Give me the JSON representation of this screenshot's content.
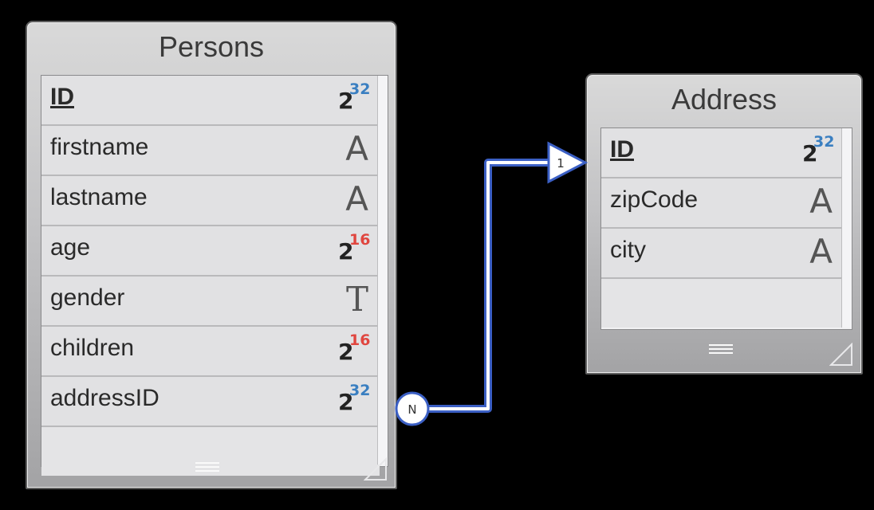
{
  "persons": {
    "title": "Persons",
    "fields": [
      {
        "name": "ID",
        "pk": true,
        "type": "int",
        "exp": "32",
        "exp_color": "#3a7fc1"
      },
      {
        "name": "firstname",
        "pk": false,
        "type": "text",
        "glyph": "A"
      },
      {
        "name": "lastname",
        "pk": false,
        "type": "text",
        "glyph": "A"
      },
      {
        "name": "age",
        "pk": false,
        "type": "int",
        "exp": "16",
        "exp_color": "#e0463f"
      },
      {
        "name": "gender",
        "pk": false,
        "type": "text-t",
        "glyph": "T"
      },
      {
        "name": "children",
        "pk": false,
        "type": "int",
        "exp": "16",
        "exp_color": "#e0463f"
      },
      {
        "name": "addressID",
        "pk": false,
        "type": "int",
        "exp": "32",
        "exp_color": "#3a7fc1"
      }
    ]
  },
  "address": {
    "title": "Address",
    "fields": [
      {
        "name": "ID",
        "pk": true,
        "type": "int",
        "exp": "32",
        "exp_color": "#3a7fc1"
      },
      {
        "name": "zipCode",
        "pk": false,
        "type": "text",
        "glyph": "A"
      },
      {
        "name": "city",
        "pk": false,
        "type": "text",
        "glyph": "A"
      }
    ]
  },
  "relation": {
    "many_label": "N",
    "one_label": "1",
    "color": "#3b5fc4"
  },
  "int_base": "2"
}
